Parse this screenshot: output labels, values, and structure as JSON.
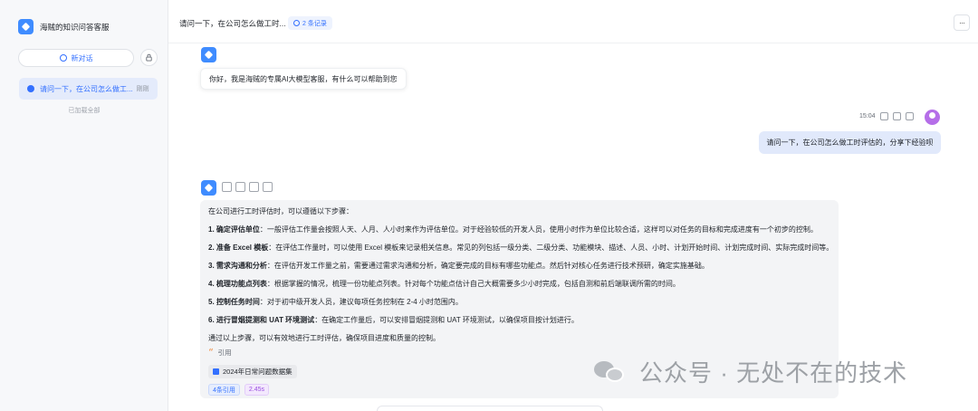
{
  "sidebar": {
    "app_name": "海贼的知识问答客服",
    "new_chat_label": "新对话",
    "conversations": [
      {
        "title": "请问一下，在公司怎么做工...",
        "time": "刚刚"
      }
    ],
    "loaded_text": "已加载全部"
  },
  "header": {
    "title": "请问一下，在公司怎么做工时...",
    "records": "2 条记录",
    "more": "···"
  },
  "chat": {
    "greeting": "你好，我是海贼的专属AI大模型客服，有什么可以帮助到您",
    "user_time": "15:04",
    "user_message": "请问一下，在公司怎么做工时评估的，分享下经验呗",
    "answer": {
      "intro": "在公司进行工时评估时，可以遵循以下步骤：",
      "steps": [
        {
          "title": "1. 确定评估单位",
          "text": "：一般评估工作量会按照人天、人月、人小时来作为评估单位。对于经验较低的开发人员，使用小时作为单位比较合适，这样可以对任务的目标和完成进度有一个初步的控制。"
        },
        {
          "title": "2. 准备 Excel 模板",
          "text": "：在评估工作量时，可以使用 Excel 模板来记录相关信息。常见的列包括一级分类、二级分类、功能模块、描述、人员、小时、计划开始时间、计划完成时间、实际完成时间等。"
        },
        {
          "title": "3. 需求沟通和分析",
          "text": "：在评估开发工作量之前，需要通过需求沟通和分析，确定要完成的目标有哪些功能点。然后针对核心任务进行技术预研，确定实施基础。"
        },
        {
          "title": "4. 梳理功能点列表",
          "text": "：根据掌握的情况，梳理一份功能点列表。针对每个功能点估计自己大概需要多少小时完成，包括自测和前后端联调所需的时间。"
        },
        {
          "title": "5. 控制任务时间",
          "text": "：对于初中级开发人员，建议每项任务控制在 2-4 小时范围内。"
        },
        {
          "title": "6. 进行冒烟提测和 UAT 环境测试",
          "text": "：在确定工作量后，可以安排冒烟提测和 UAT 环境测试，以确保项目按计划进行。"
        }
      ],
      "conclusion": "通过以上步骤，可以有效地进行工时评估，确保项目进度和质量的控制。",
      "quote_label": "引用",
      "dataset": "2024年日常问题数据集",
      "citations": "4条引用",
      "elapsed": "2.45s"
    }
  },
  "watermark": "公众号 · 无处不在的技术",
  "colors": {
    "accent": "#3370ff",
    "user_bubble": "#e1e9fb",
    "answer_bg": "#f3f4f6"
  }
}
